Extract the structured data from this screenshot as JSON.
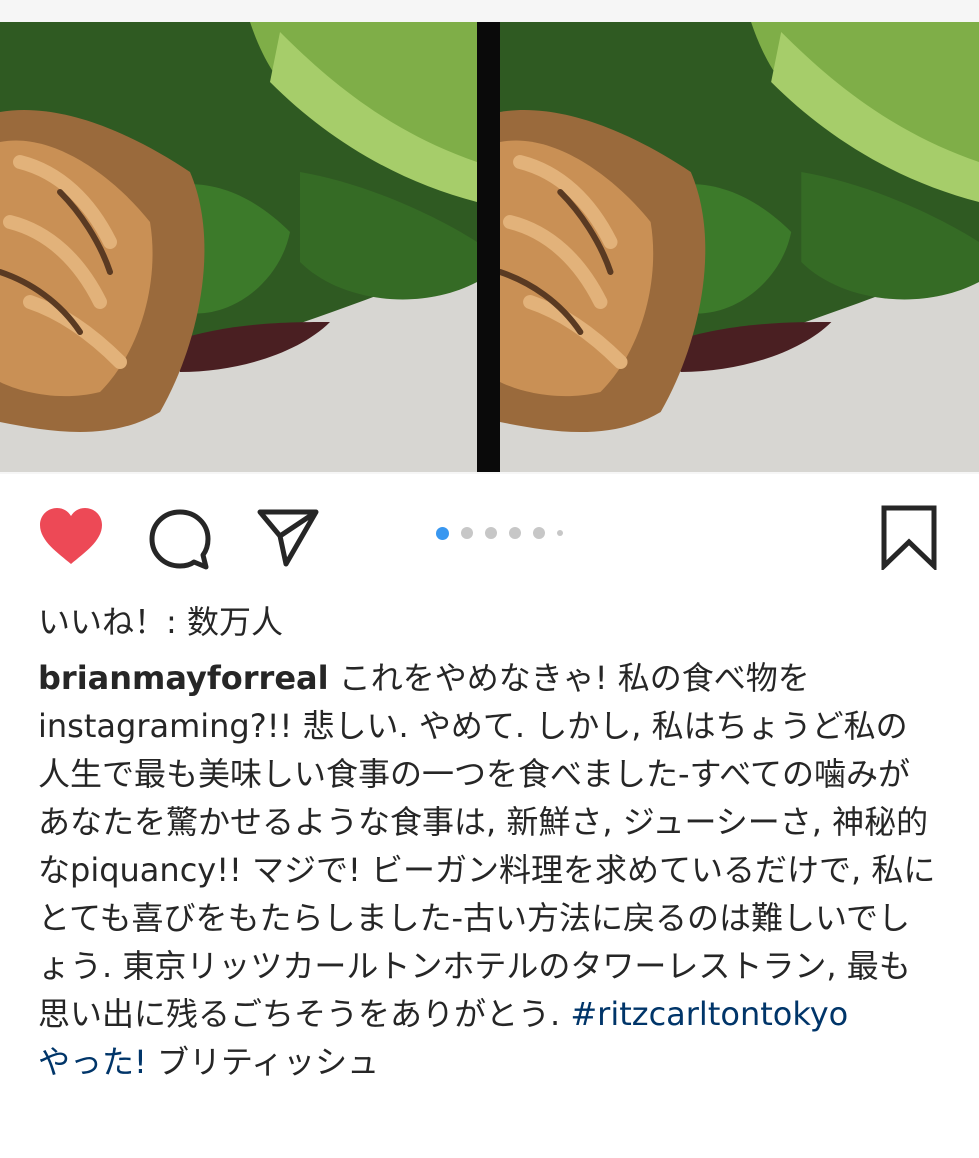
{
  "post": {
    "likes_text": "いいね！: 数万人",
    "username": "brianmayforreal",
    "caption_body": " これをやめなきゃ! 私の食べ物をinstagraming?!! 悲しい. やめて. しかし, 私はちょうど私の人生で最も美味しい食事の一つを食べました-すべての噛みがあなたを驚かせるような食事は, 新鮮さ, ジューシーさ, 神秘的なpiquancy!! マジで! ビーガン料理を求めているだけで, 私にとても喜びをもたらしました-古い方法に戻るのは難しいでしょう. 東京リッツカールトンホテルのタワーレストラン, 最も思い出に残るごちそうをありがとう. ",
    "hashtag": "#ritzcarltontokyo",
    "caption_tail_link": "やった!",
    "caption_tail": " ブリティッシュ"
  },
  "carousel": {
    "count": 6,
    "active_index": 0
  },
  "icons": {
    "like": "heart-icon",
    "comment": "comment-icon",
    "share": "share-icon",
    "save": "bookmark-icon"
  },
  "colors": {
    "like_red": "#ed4956",
    "active_dot": "#3897f0",
    "inactive_dot": "#c7c7c7",
    "hashtag_link": "#003569",
    "text": "#262626"
  }
}
